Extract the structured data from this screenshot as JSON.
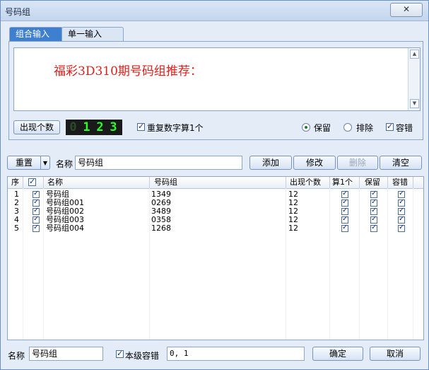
{
  "window": {
    "title": "号码组",
    "close_label": "✕"
  },
  "tabs": [
    {
      "label": "组合输入"
    },
    {
      "label": "单一输入"
    }
  ],
  "textarea": {
    "text": "福彩3D310期号码组推荐："
  },
  "controls": {
    "count_button": "出现个数",
    "lcd_digits": [
      "0",
      "1",
      "2",
      "3"
    ],
    "repeat_check_label": "重复数字算1个",
    "keep_label": "保留",
    "exclude_label": "排除",
    "tolerance_label": "容错"
  },
  "toolbar": {
    "reset_label": "重置",
    "name_label": "名称",
    "name_value": "号码组",
    "add_label": "添加",
    "modify_label": "修改",
    "delete_label": "删除",
    "clear_label": "清空"
  },
  "grid": {
    "headers": [
      "序",
      "",
      "名称",
      "号码组",
      "出现个数",
      "算1个",
      "保留",
      "容错"
    ],
    "rows": [
      {
        "index": "1",
        "name": "号码组",
        "numbers": "1349",
        "count": "12"
      },
      {
        "index": "2",
        "name": "号码组001",
        "numbers": "0269",
        "count": "12"
      },
      {
        "index": "3",
        "name": "号码组002",
        "numbers": "3489",
        "count": "12"
      },
      {
        "index": "4",
        "name": "号码组003",
        "numbers": "0358",
        "count": "12"
      },
      {
        "index": "5",
        "name": "号码组004",
        "numbers": "1268",
        "count": "12"
      }
    ]
  },
  "footer": {
    "name_label": "名称",
    "name_value": "号码组",
    "level_tolerance_label": "本级容错",
    "tolerance_value": "0, 1",
    "ok_label": "确定",
    "cancel_label": "取消"
  },
  "colors": {
    "accent": "#3f7fd0",
    "title_text": "#e0201b",
    "lcd_green": "#2bff2b",
    "lcd_dim": "#2b4a2b"
  }
}
